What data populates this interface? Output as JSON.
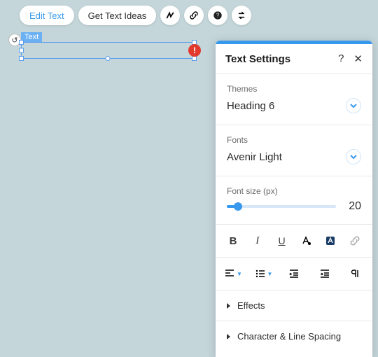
{
  "toolbar": {
    "edit_text": "Edit Text",
    "get_ideas": "Get Text Ideas"
  },
  "canvas": {
    "element_label": "Text"
  },
  "panel": {
    "title": "Text Settings",
    "themes": {
      "label": "Themes",
      "value": "Heading 6"
    },
    "fonts": {
      "label": "Fonts",
      "value": "Avenir Light"
    },
    "font_size": {
      "label": "Font size (px)",
      "value": "20"
    },
    "effects": "Effects",
    "spacing": "Character & Line Spacing"
  }
}
